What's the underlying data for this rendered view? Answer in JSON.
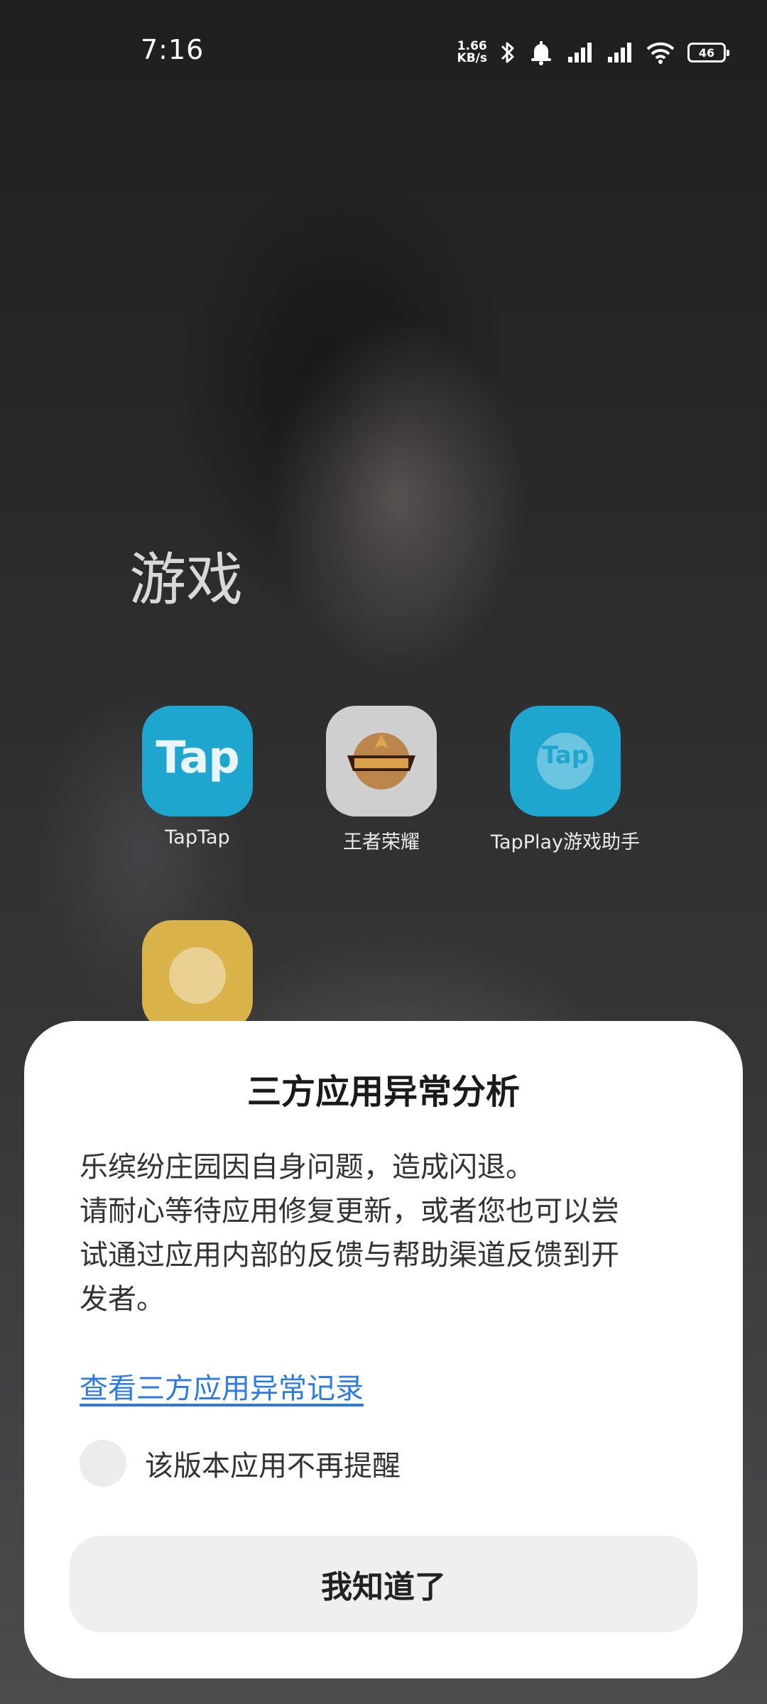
{
  "status_bar": {
    "time": "7:16",
    "net_speed_value": "1.66",
    "net_speed_unit": "KB/s",
    "battery": "46",
    "icons": [
      "bluetooth-icon",
      "alarm-icon",
      "signal-icon",
      "signal-icon",
      "wifi-icon",
      "battery-icon"
    ]
  },
  "folder": {
    "title": "游戏",
    "apps": [
      {
        "label": "TapTap",
        "icon_text": "Tap",
        "icon": "taptap-icon",
        "color": "#1ea6cf"
      },
      {
        "label": "王者荣耀",
        "icon": "honor-of-kings-icon",
        "color": "#cfcfcf"
      },
      {
        "label": "TapPlay游戏助手",
        "icon_text": "Tap",
        "icon": "tapplay-icon",
        "color": "#1ea6cf"
      },
      {
        "label": "",
        "icon": "yellow-game-icon",
        "color": "#d9b24a"
      }
    ]
  },
  "dialog": {
    "title": "三方应用异常分析",
    "message_lines": [
      "乐缤纷庄园因自身问题，造成闪退。",
      "请耐心等待应用修复更新，或者您也可以尝",
      "试通过应用内部的反馈与帮助渠道反馈到开",
      "发者。"
    ],
    "link_text": "查看三方应用异常记录",
    "checkbox_label": "该版本应用不再提醒",
    "checkbox_checked": false,
    "button_label": "我知道了",
    "link_color": "#2d7be0"
  }
}
